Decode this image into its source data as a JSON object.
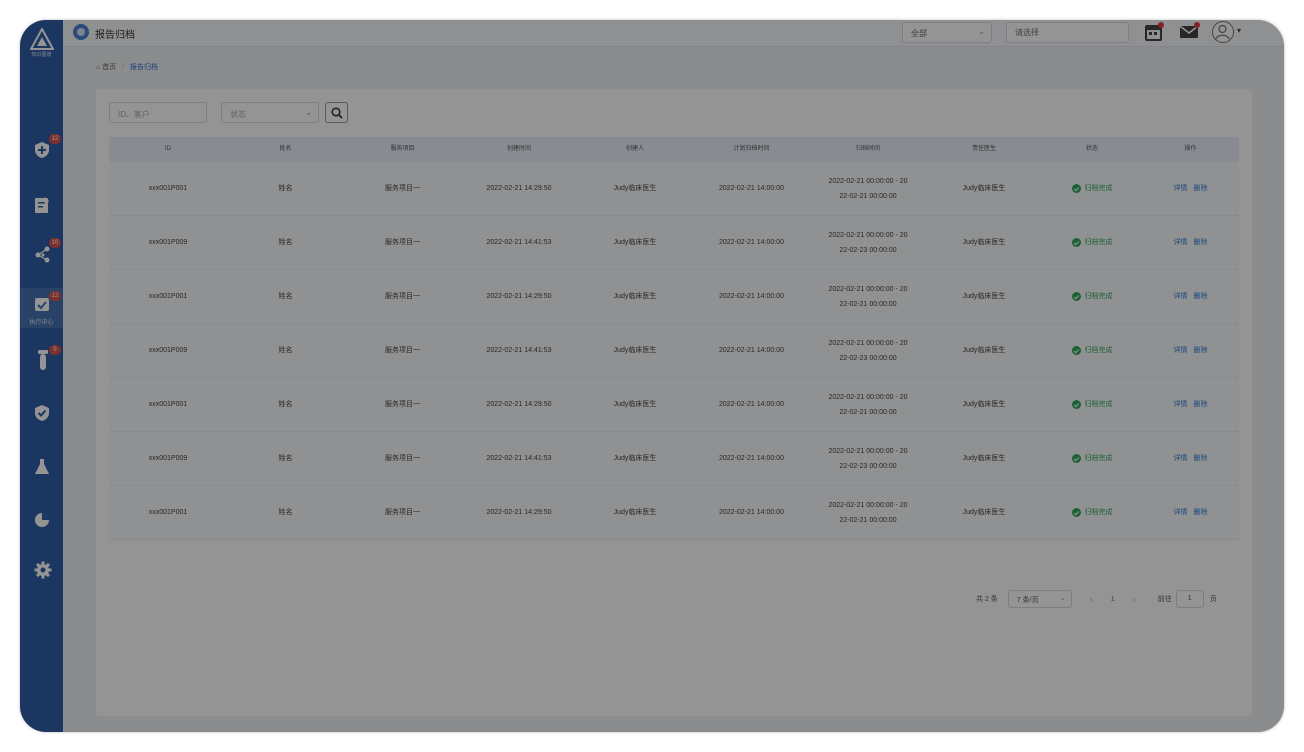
{
  "app": {
    "title": "报告归档"
  },
  "sidebar": {
    "logo_text": "知识图谱",
    "items": [
      {
        "icon": "shield-plus-icon",
        "badge": "12",
        "label": ""
      },
      {
        "icon": "notepad-icon",
        "badge": "",
        "label": ""
      },
      {
        "icon": "share-network-icon",
        "badge": "10",
        "label": ""
      },
      {
        "icon": "calendar-check-icon",
        "badge": "12",
        "label": "执行中心"
      },
      {
        "icon": "test-tube-icon",
        "badge": "9",
        "label": ""
      },
      {
        "icon": "shield-check-icon",
        "badge": "",
        "label": ""
      },
      {
        "icon": "flask-icon",
        "badge": "",
        "label": ""
      },
      {
        "icon": "pie-chart-icon",
        "badge": "",
        "label": ""
      },
      {
        "icon": "gear-icon",
        "badge": "",
        "label": ""
      }
    ]
  },
  "topbar": {
    "scope_select": "全部",
    "search_placeholder": "请选择",
    "user_chevron": "▾"
  },
  "breadcrumb": {
    "home": "首页",
    "separator": "/",
    "current": "报告归档"
  },
  "filters": {
    "keyword_placeholder": "ID、客户",
    "status_placeholder": "状态"
  },
  "table": {
    "headers": [
      "ID",
      "姓名",
      "服务项目",
      "创建时间",
      "创建人",
      "计划归档时间",
      "归档时间",
      "责任医生",
      "状态",
      "操作"
    ],
    "rows": [
      {
        "id": "xxx001P001",
        "name": "姓名",
        "service": "服务项目一",
        "created": "2022-02-21 14:29:50",
        "creator": "Judy临床医生",
        "planned": "2022-02-21 14:00:00",
        "archive_a": "2022-02-21 00:00:00 - 20",
        "archive_b": "22-02-21 00:00:00",
        "doctor": "Judy临床医生",
        "status": "归档完成",
        "op_detail": "详情",
        "op_delete": "删除"
      },
      {
        "id": "xxx001P009",
        "name": "姓名",
        "service": "服务项目一",
        "created": "2022-02-21 14:41:53",
        "creator": "Judy临床医生",
        "planned": "2022-02-21 14:00:00",
        "archive_a": "2022-02-21 00:00:00 - 20",
        "archive_b": "22-02-23 00:00:00",
        "doctor": "Judy临床医生",
        "status": "归档完成",
        "op_detail": "详情",
        "op_delete": "删除"
      },
      {
        "id": "xxx001P001",
        "name": "姓名",
        "service": "服务项目一",
        "created": "2022-02-21 14:29:50",
        "creator": "Judy临床医生",
        "planned": "2022-02-21 14:00:00",
        "archive_a": "2022-02-21 00:00:00 - 20",
        "archive_b": "22-02-21 00:00:00",
        "doctor": "Judy临床医生",
        "status": "归档完成",
        "op_detail": "详情",
        "op_delete": "删除"
      },
      {
        "id": "xxx001P009",
        "name": "姓名",
        "service": "服务项目一",
        "created": "2022-02-21 14:41:53",
        "creator": "Judy临床医生",
        "planned": "2022-02-21 14:00:00",
        "archive_a": "2022-02-21 00:00:00 - 20",
        "archive_b": "22-02-23 00:00:00",
        "doctor": "Judy临床医生",
        "status": "归档完成",
        "op_detail": "详情",
        "op_delete": "删除"
      },
      {
        "id": "xxx001P001",
        "name": "姓名",
        "service": "服务项目一",
        "created": "2022-02-21 14:29:50",
        "creator": "Judy临床医生",
        "planned": "2022-02-21 14:00:00",
        "archive_a": "2022-02-21 00:00:00 - 20",
        "archive_b": "22-02-21 00:00:00",
        "doctor": "Judy临床医生",
        "status": "归档完成",
        "op_detail": "详情",
        "op_delete": "删除"
      },
      {
        "id": "xxx001P009",
        "name": "姓名",
        "service": "服务项目一",
        "created": "2022-02-21 14:41:53",
        "creator": "Judy临床医生",
        "planned": "2022-02-21 14:00:00",
        "archive_a": "2022-02-21 00:00:00 - 20",
        "archive_b": "22-02-23 00:00:00",
        "doctor": "Judy临床医生",
        "status": "归档完成",
        "op_detail": "详情",
        "op_delete": "删除"
      },
      {
        "id": "xxx001P001",
        "name": "姓名",
        "service": "服务项目一",
        "created": "2022-02-21 14:29:50",
        "creator": "Judy临床医生",
        "planned": "2022-02-21 14:00:00",
        "archive_a": "2022-02-21 00:00:00 - 20",
        "archive_b": "22-02-21 00:00:00",
        "doctor": "Judy临床医生",
        "status": "归档完成",
        "op_detail": "详情",
        "op_delete": "删除"
      }
    ]
  },
  "pagination": {
    "total": "共 2 条",
    "page_size": "7 条/页",
    "prev": "‹",
    "current_page": "1",
    "next": "›",
    "goto_label": "前往",
    "goto_value": "1",
    "goto_unit": "页"
  },
  "colors": {
    "sidebar": "#2d5ea8",
    "accent": "#2e6fd0",
    "success": "#2fa85a",
    "badge": "#d9534f",
    "overlay": "rgba(0,0,0,0.42)"
  }
}
